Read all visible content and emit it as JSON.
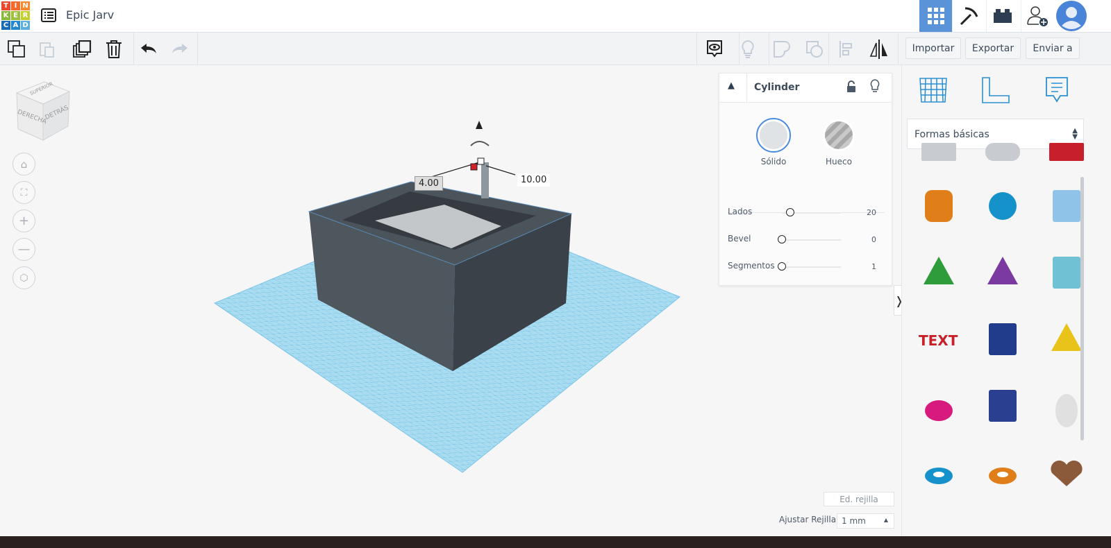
{
  "app": {
    "logo_letters": [
      "T",
      "I",
      "N",
      "K",
      "E",
      "R",
      "C",
      "A",
      "D"
    ],
    "logo_colors": [
      "#e8492f",
      "#f36a2b",
      "#f7882e",
      "#8ab838",
      "#9dc03f",
      "#c3d130",
      "#1a6bb5",
      "#2488ce",
      "#5aaee0"
    ],
    "project_title": "Epic Jarv"
  },
  "topbar_right": {
    "items": [
      {
        "name": "3d-design",
        "icon": "grid-icon",
        "active": true
      },
      {
        "name": "minecraft",
        "icon": "pickaxe-icon"
      },
      {
        "name": "lego",
        "icon": "brick-icon"
      },
      {
        "name": "invite",
        "icon": "add-user-icon"
      },
      {
        "name": "profile",
        "icon": "avatar-icon"
      }
    ],
    "accent": "#5b93d8"
  },
  "toolbar": {
    "left_icons": [
      "copy-icon",
      "paste-icon",
      "duplicate-icon",
      "trash-icon",
      "undo-icon",
      "redo-icon"
    ],
    "right_icons": [
      "notes-eye-icon",
      "lightbulb-icon",
      "group-icon",
      "ungroup-icon",
      "align-icon",
      "mirror-icon"
    ],
    "import_label": "Importar",
    "export_label": "Exportar",
    "send_label": "Enviar a"
  },
  "viewcube": {
    "right": "DERECHA",
    "back": "DETRÁS",
    "top": "SUPERIOR"
  },
  "nav_buttons": [
    "home-icon",
    "fit-icon",
    "zoom-in-icon",
    "zoom-out-icon",
    "perspective-icon"
  ],
  "scene": {
    "dim_left": "4.00",
    "dim_right": "10.00",
    "grid_color": "#9fd6ee",
    "box_color": "#4b535b"
  },
  "inspector": {
    "title": "Cylinder",
    "solid_label": "Sólido",
    "hole_label": "Hueco",
    "props": [
      {
        "label": "Lados",
        "value": "20",
        "fraction": 0.05
      },
      {
        "label": "Bevel",
        "value": "0",
        "fraction": 0
      },
      {
        "label": "Segmentos",
        "value": "1",
        "fraction": 0
      }
    ]
  },
  "right_panel": {
    "tab_icons": [
      "workplane-icon",
      "ruler-icon",
      "notes-icon"
    ],
    "category": "Formas básicas",
    "shapes": [
      "box-hole",
      "cylinder-hole",
      "box",
      "cylinder",
      "sphere",
      "scribble",
      "roof",
      "cone",
      "round-roof",
      "text",
      "wedge",
      "pyramid",
      "half-sphere",
      "polygon",
      "paraboloid",
      "torus",
      "tube",
      "heart"
    ]
  },
  "bottom": {
    "edit_grid": "Ed. rejilla",
    "snap_label": "Ajustar Rejilla",
    "snap_value": "1 mm"
  }
}
